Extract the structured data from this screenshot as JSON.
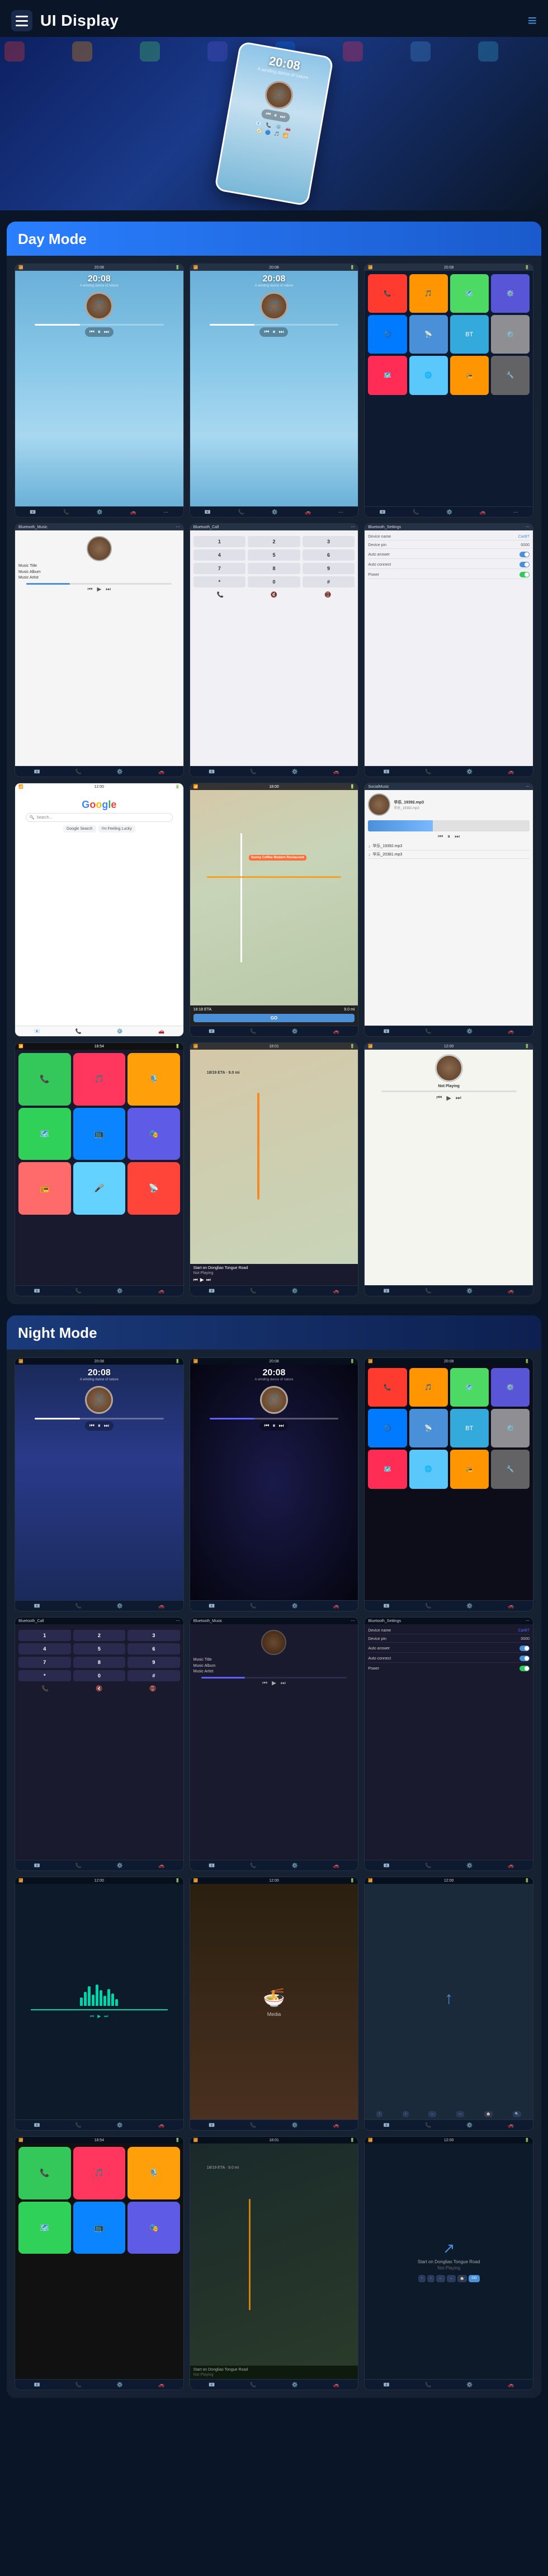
{
  "header": {
    "title": "UI Display",
    "menu_label": "≡"
  },
  "day_mode": {
    "label": "Day Mode",
    "screens": [
      {
        "type": "music_day_1",
        "time": "20:08",
        "subtitle": "A winding dance of nature"
      },
      {
        "type": "music_day_2",
        "time": "20:08",
        "subtitle": "A winding dance of nature"
      },
      {
        "type": "app_grid"
      },
      {
        "type": "bluetooth_music"
      },
      {
        "type": "bluetooth_call"
      },
      {
        "type": "bluetooth_settings"
      },
      {
        "type": "google"
      },
      {
        "type": "map_navigation"
      },
      {
        "type": "social_music"
      },
      {
        "type": "carplay_home"
      },
      {
        "type": "map_nav_2"
      },
      {
        "type": "music_now_playing"
      }
    ]
  },
  "night_mode": {
    "label": "Night Mode",
    "screens": [
      {
        "type": "music_night_1",
        "time": "20:08",
        "subtitle": "A winding dance of nature"
      },
      {
        "type": "music_night_2",
        "time": "20:08",
        "subtitle": "A winding dance of nature"
      },
      {
        "type": "app_grid_night"
      },
      {
        "type": "bluetooth_call_night"
      },
      {
        "type": "bluetooth_music_night"
      },
      {
        "type": "bluetooth_settings_night"
      },
      {
        "type": "eq_night"
      },
      {
        "type": "food_night"
      },
      {
        "type": "nav_night"
      },
      {
        "type": "carplay_night"
      },
      {
        "type": "map_night"
      },
      {
        "type": "nav_night_2"
      }
    ]
  },
  "music_text": {
    "title": "Music Title",
    "album": "Music Album",
    "artist": "Music Artist"
  },
  "bt_settings": {
    "device_name_label": "Device name",
    "device_name_val": "CarBT",
    "device_pin_label": "Device pin",
    "device_pin_val": "0000",
    "auto_answer_label": "Auto answer",
    "auto_connect_label": "Auto connect",
    "power_label": "Power"
  },
  "map_info": {
    "restaurant": "Sunny Coffee Modern Restaurant",
    "eta_label": "18:18 ETA",
    "distance": "9.0 mi",
    "go": "GO",
    "start": "Start on Dongliao Tongue Road",
    "not_playing": "Not Playing"
  },
  "bottom_nav": {
    "items": [
      "📧",
      "📱",
      "🔊",
      "🚗",
      "⚙️"
    ]
  },
  "app_icons_day": [
    {
      "icon": "📞",
      "bg": "#4cd964"
    },
    {
      "icon": "📱",
      "bg": "#ff3b30"
    },
    {
      "icon": "🎵",
      "bg": "#ff9500"
    },
    {
      "icon": "📷",
      "bg": "#5856d6"
    },
    {
      "icon": "🔵",
      "bg": "#007aff"
    },
    {
      "icon": "📡",
      "bg": "#4a90d9"
    },
    {
      "icon": "🎮",
      "bg": "#34aadc"
    },
    {
      "icon": "⚙️",
      "bg": "#8e8e93"
    },
    {
      "icon": "🗺️",
      "bg": "#ff2d55"
    },
    {
      "icon": "🌐",
      "bg": "#5ac8fa"
    },
    {
      "icon": "📻",
      "bg": "#ff9500"
    },
    {
      "icon": "🔧",
      "bg": "#636366"
    }
  ],
  "app_icons_carplay": [
    {
      "icon": "📞",
      "bg": "#34c759"
    },
    {
      "icon": "🎵",
      "bg": "#ff375f"
    },
    {
      "icon": "🎙️",
      "bg": "#ff9f0a"
    },
    {
      "icon": "🗺️",
      "bg": "#30d158"
    },
    {
      "icon": "📺",
      "bg": "#0a84ff"
    },
    {
      "icon": "🎭",
      "bg": "#5e5ce6"
    },
    {
      "icon": "📻",
      "bg": "#ff6b6b"
    },
    {
      "icon": "🎤",
      "bg": "#64d2ff"
    },
    {
      "icon": "📡",
      "bg": "#ff453a"
    }
  ]
}
